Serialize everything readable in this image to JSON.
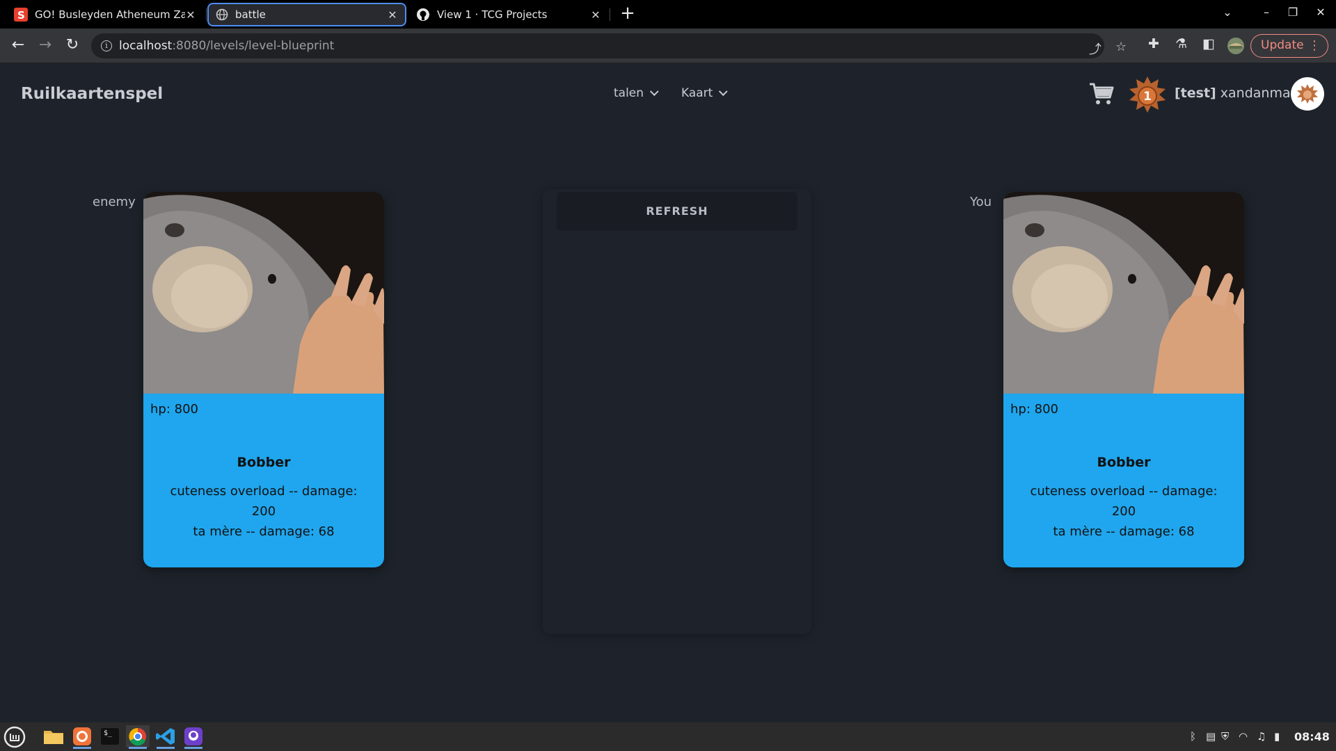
{
  "browser": {
    "tabs": [
      {
        "title": "GO! Busleyden Atheneum Za",
        "favicon": "smartschool-icon",
        "active": false
      },
      {
        "title": "battle",
        "favicon": "globe-icon",
        "active": true
      },
      {
        "title": "View 1 · TCG Projects",
        "favicon": "github-icon",
        "active": false
      }
    ],
    "url_host": "localhost",
    "url_rest": ":8080/levels/level-blueprint",
    "update_label": "Update"
  },
  "app": {
    "brand": "Ruilkaartenspel",
    "menus": [
      {
        "label": "talen"
      },
      {
        "label": "Kaart"
      }
    ],
    "rank": "1",
    "user_tag": "[test]",
    "username": "xandanman"
  },
  "battle": {
    "enemy_label": "enemy",
    "player_label": "You",
    "refresh_label": "REFRESH",
    "enemy_card": {
      "hp": "hp: 800",
      "name": "Bobber",
      "attacks": [
        "cuteness overload -- damage:",
        "200",
        "ta mère -- damage: 68"
      ]
    },
    "player_card": {
      "hp": "hp: 800",
      "name": "Bobber",
      "attacks": [
        "cuteness overload -- damage:",
        "200",
        "ta mère -- damage: 68"
      ]
    },
    "card_color": "#1fa6ee"
  },
  "taskbar": {
    "apps": [
      "files-icon",
      "firefox-icon",
      "terminal-icon",
      "chrome-icon",
      "vscode-icon",
      "github-desktop-icon"
    ],
    "time": "08:48"
  }
}
